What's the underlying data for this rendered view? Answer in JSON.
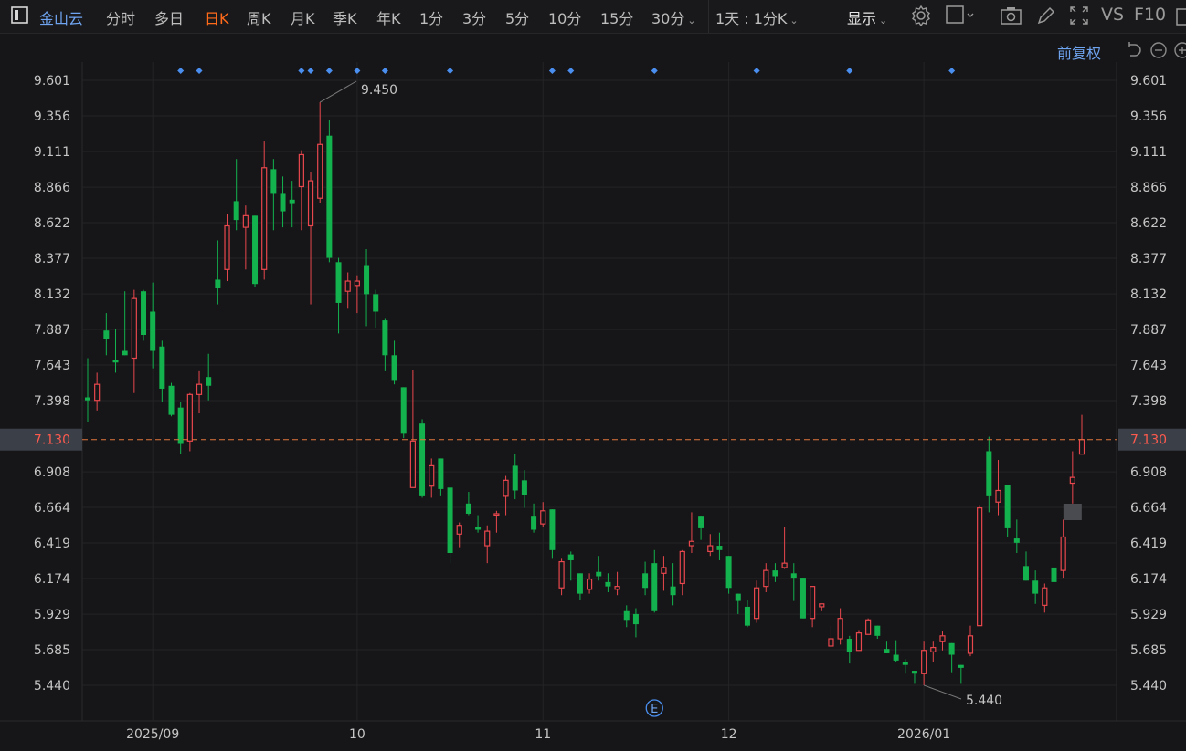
{
  "toolbar": {
    "panel_icon": "panel-toggle-icon",
    "stock_name": "金山云",
    "periods": [
      "分时",
      "多日",
      "日K",
      "周K",
      "月K",
      "季K",
      "年K",
      "1分",
      "3分",
      "5分",
      "10分",
      "15分",
      "30分"
    ],
    "active_period": "日K",
    "interval_select": "1天 : 1分K",
    "display_label": "显示",
    "vs_label": "VS",
    "f10_label": "F10",
    "icons": [
      "gear-icon",
      "layout-square-icon",
      "camera-icon",
      "pencil-icon",
      "fullscreen-icon"
    ]
  },
  "subbar": {
    "adjust_label": "前复权",
    "icons": [
      "undo-icon",
      "zoom-out-icon",
      "zoom-in-icon"
    ]
  },
  "colors": {
    "up": "#e8474d",
    "down": "#13b24e",
    "accent": "#6fa4f0",
    "active": "#ff6a1a",
    "price_line": "#e0763a",
    "marker": "#4a8ff0"
  },
  "chart_data": {
    "type": "candlestick",
    "ylim": [
      5.44,
      9.601
    ],
    "y_ticks": [
      "9.601",
      "9.356",
      "9.111",
      "8.866",
      "8.622",
      "8.377",
      "8.132",
      "7.887",
      "7.643",
      "7.398",
      "6.908",
      "6.664",
      "6.419",
      "6.174",
      "5.929",
      "5.685",
      "5.440"
    ],
    "current_price": "7.130",
    "grid": true,
    "x_ticks": [
      {
        "label": "2025/09",
        "index": 7
      },
      {
        "label": "10",
        "index": 29
      },
      {
        "label": "11",
        "index": 49
      },
      {
        "label": "12",
        "index": 69
      },
      {
        "label": "2026/01",
        "index": 90
      }
    ],
    "max_label": {
      "text": "9.450",
      "index": 25
    },
    "min_label": {
      "text": "5.440",
      "index": 90
    },
    "event_markers": [
      10,
      12,
      23,
      24,
      26,
      29,
      32,
      39,
      50,
      52,
      61,
      72,
      82,
      93
    ],
    "earnings_marker": {
      "text": "E",
      "index": 61
    },
    "ohlc_columns": [
      "open",
      "high",
      "low",
      "close"
    ],
    "ohlc": [
      [
        7.42,
        7.69,
        7.25,
        7.4
      ],
      [
        7.4,
        7.59,
        7.33,
        7.51
      ],
      [
        7.88,
        8.0,
        7.71,
        7.82
      ],
      [
        7.68,
        7.89,
        7.59,
        7.66
      ],
      [
        7.74,
        8.15,
        7.71,
        7.71
      ],
      [
        7.69,
        8.16,
        7.45,
        8.1
      ],
      [
        8.15,
        8.16,
        7.81,
        7.85
      ],
      [
        8.01,
        8.21,
        7.62,
        7.74
      ],
      [
        7.77,
        7.81,
        7.39,
        7.48
      ],
      [
        7.5,
        7.52,
        7.29,
        7.3
      ],
      [
        7.35,
        7.39,
        7.03,
        7.1
      ],
      [
        7.12,
        7.45,
        7.05,
        7.44
      ],
      [
        7.44,
        7.6,
        7.31,
        7.51
      ],
      [
        7.56,
        7.72,
        7.4,
        7.5
      ],
      [
        8.23,
        8.5,
        8.06,
        8.17
      ],
      [
        8.3,
        8.68,
        8.22,
        8.6
      ],
      [
        8.77,
        9.06,
        8.57,
        8.64
      ],
      [
        8.59,
        8.74,
        8.3,
        8.67
      ],
      [
        8.67,
        8.67,
        8.18,
        8.2
      ],
      [
        8.3,
        9.18,
        8.23,
        9.0
      ],
      [
        8.99,
        9.06,
        8.57,
        8.82
      ],
      [
        8.82,
        8.94,
        8.59,
        8.7
      ],
      [
        8.78,
        8.91,
        8.59,
        8.75
      ],
      [
        8.87,
        9.12,
        8.57,
        9.09
      ],
      [
        8.6,
        8.97,
        8.06,
        8.91
      ],
      [
        8.79,
        9.45,
        8.76,
        9.16
      ],
      [
        9.22,
        9.33,
        8.35,
        8.38
      ],
      [
        8.35,
        8.38,
        7.86,
        8.07
      ],
      [
        8.15,
        8.28,
        8.03,
        8.22
      ],
      [
        8.19,
        8.26,
        8.0,
        8.22
      ],
      [
        8.33,
        8.44,
        7.91,
        8.13
      ],
      [
        8.13,
        8.16,
        7.9,
        8.01
      ],
      [
        7.95,
        7.96,
        7.6,
        7.71
      ],
      [
        7.71,
        7.81,
        7.51,
        7.54
      ],
      [
        7.49,
        7.49,
        7.14,
        7.17
      ],
      [
        6.8,
        7.61,
        6.8,
        7.12
      ],
      [
        7.24,
        7.27,
        6.73,
        6.74
      ],
      [
        6.81,
        7.0,
        6.73,
        6.95
      ],
      [
        7.0,
        7.0,
        6.74,
        6.79
      ],
      [
        6.8,
        6.8,
        6.28,
        6.35
      ],
      [
        6.48,
        6.56,
        6.39,
        6.54
      ],
      [
        6.69,
        6.77,
        6.61,
        6.62
      ],
      [
        6.53,
        6.61,
        6.49,
        6.51
      ],
      [
        6.4,
        6.54,
        6.28,
        6.5
      ],
      [
        6.61,
        6.64,
        6.49,
        6.62
      ],
      [
        6.74,
        6.88,
        6.61,
        6.85
      ],
      [
        6.95,
        7.03,
        6.72,
        6.78
      ],
      [
        6.85,
        6.92,
        6.66,
        6.75
      ],
      [
        6.6,
        6.69,
        6.49,
        6.51
      ],
      [
        6.55,
        6.7,
        6.53,
        6.64
      ],
      [
        6.65,
        6.65,
        6.31,
        6.37
      ],
      [
        6.11,
        6.31,
        6.06,
        6.29
      ],
      [
        6.34,
        6.36,
        6.16,
        6.3
      ],
      [
        6.21,
        6.21,
        6.03,
        6.07
      ],
      [
        6.1,
        6.21,
        6.07,
        6.17
      ],
      [
        6.22,
        6.33,
        6.16,
        6.19
      ],
      [
        6.15,
        6.21,
        6.08,
        6.12
      ],
      [
        6.1,
        6.22,
        6.06,
        6.12
      ],
      [
        5.95,
        5.99,
        5.84,
        5.89
      ],
      [
        5.93,
        5.97,
        5.77,
        5.86
      ],
      [
        6.21,
        6.29,
        6.06,
        6.11
      ],
      [
        6.28,
        6.37,
        5.94,
        5.95
      ],
      [
        6.21,
        6.33,
        6.09,
        6.25
      ],
      [
        6.12,
        6.28,
        5.99,
        6.06
      ],
      [
        6.14,
        6.37,
        6.06,
        6.36
      ],
      [
        6.4,
        6.63,
        6.35,
        6.43
      ],
      [
        6.6,
        6.6,
        6.44,
        6.52
      ],
      [
        6.36,
        6.48,
        6.33,
        6.4
      ],
      [
        6.4,
        6.49,
        6.3,
        6.37
      ],
      [
        6.33,
        6.33,
        6.07,
        6.11
      ],
      [
        6.07,
        6.07,
        5.93,
        6.02
      ],
      [
        5.98,
        6.03,
        5.84,
        5.85
      ],
      [
        5.9,
        6.16,
        5.87,
        6.11
      ],
      [
        6.12,
        6.28,
        6.08,
        6.23
      ],
      [
        6.23,
        6.28,
        6.15,
        6.19
      ],
      [
        6.25,
        6.53,
        6.24,
        6.28
      ],
      [
        6.21,
        6.28,
        6.02,
        6.18
      ],
      [
        6.18,
        6.18,
        5.9,
        5.9
      ],
      [
        5.9,
        6.12,
        5.84,
        6.12
      ],
      [
        5.98,
        6.0,
        5.95,
        6.0
      ],
      [
        5.71,
        5.85,
        5.71,
        5.76
      ],
      [
        5.76,
        5.97,
        5.72,
        5.9
      ],
      [
        5.76,
        5.78,
        5.59,
        5.67
      ],
      [
        5.68,
        5.82,
        5.68,
        5.8
      ],
      [
        5.79,
        5.9,
        5.79,
        5.89
      ],
      [
        5.85,
        5.85,
        5.76,
        5.78
      ],
      [
        5.69,
        5.74,
        5.66,
        5.66
      ],
      [
        5.65,
        5.75,
        5.6,
        5.61
      ],
      [
        5.6,
        5.62,
        5.52,
        5.58
      ],
      [
        5.54,
        5.54,
        5.45,
        5.52
      ],
      [
        5.52,
        5.74,
        5.44,
        5.68
      ],
      [
        5.67,
        5.74,
        5.6,
        5.7
      ],
      [
        5.74,
        5.81,
        5.68,
        5.78
      ],
      [
        5.73,
        5.73,
        5.53,
        5.65
      ],
      [
        5.58,
        5.58,
        5.45,
        5.56
      ],
      [
        5.66,
        5.85,
        5.64,
        5.78
      ],
      [
        5.85,
        6.68,
        5.85,
        6.66
      ],
      [
        7.05,
        7.15,
        6.63,
        6.74
      ],
      [
        6.7,
        6.99,
        6.61,
        6.78
      ],
      [
        6.82,
        6.82,
        6.46,
        6.52
      ],
      [
        6.45,
        6.58,
        6.35,
        6.42
      ],
      [
        6.26,
        6.36,
        6.16,
        6.16
      ],
      [
        6.16,
        6.23,
        6.0,
        6.07
      ],
      [
        5.99,
        6.14,
        5.94,
        6.11
      ],
      [
        6.25,
        6.25,
        6.06,
        6.15
      ],
      [
        6.23,
        6.58,
        6.18,
        6.46
      ],
      [
        6.83,
        7.05,
        6.69,
        6.87
      ],
      [
        7.03,
        7.3,
        7.03,
        7.13
      ]
    ]
  }
}
